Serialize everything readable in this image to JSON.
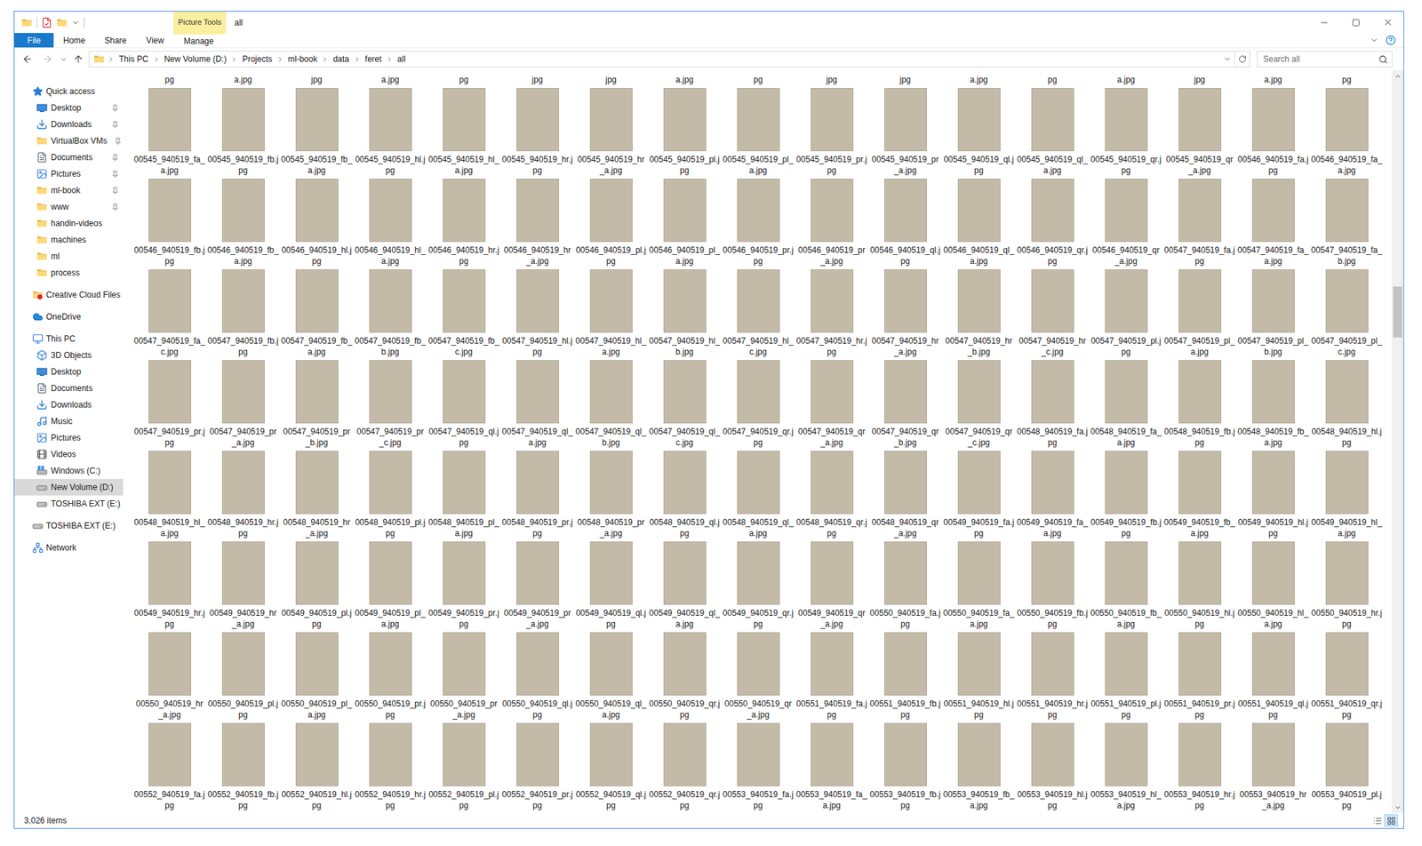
{
  "window": {
    "title": "all",
    "context_label": "Picture Tools"
  },
  "ribbon_tabs": [
    {
      "label": "File",
      "kind": "file",
      "selected": false
    },
    {
      "label": "Home",
      "kind": "tab",
      "selected": false
    },
    {
      "label": "Share",
      "kind": "tab",
      "selected": false
    },
    {
      "label": "View",
      "kind": "tab",
      "selected": false
    },
    {
      "label": "Manage",
      "kind": "contextual",
      "selected": false
    }
  ],
  "nav": {
    "back_disabled": false,
    "forward_disabled": true,
    "up_disabled": false
  },
  "breadcrumb": [
    "This PC",
    "New Volume (D:)",
    "Projects",
    "ml-book",
    "data",
    "feret",
    "all"
  ],
  "search": {
    "placeholder": "Search all"
  },
  "sidebar": {
    "groups": [
      {
        "label": "Quick access",
        "selected": false,
        "children": [
          {
            "label": "Desktop",
            "pinned": true,
            "selected": false
          },
          {
            "label": "Downloads",
            "pinned": true,
            "selected": false
          },
          {
            "label": "VirtualBox VMs",
            "pinned": true,
            "selected": false
          },
          {
            "label": "Documents",
            "pinned": true,
            "selected": false
          },
          {
            "label": "Pictures",
            "pinned": true,
            "selected": false
          },
          {
            "label": "ml-book",
            "pinned": true,
            "selected": false
          },
          {
            "label": "www",
            "pinned": true,
            "selected": false
          },
          {
            "label": "handin-videos",
            "pinned": false,
            "selected": false
          },
          {
            "label": "machines",
            "pinned": false,
            "selected": false
          },
          {
            "label": "ml",
            "pinned": false,
            "selected": false
          },
          {
            "label": "process",
            "pinned": false,
            "selected": false
          }
        ]
      },
      {
        "label": "Creative Cloud Files",
        "selected": false,
        "children": []
      },
      {
        "label": "OneDrive",
        "selected": false,
        "children": []
      },
      {
        "label": "This PC",
        "selected": false,
        "children": [
          {
            "label": "3D Objects",
            "pinned": false,
            "selected": false
          },
          {
            "label": "Desktop",
            "pinned": false,
            "selected": false
          },
          {
            "label": "Documents",
            "pinned": false,
            "selected": false
          },
          {
            "label": "Downloads",
            "pinned": false,
            "selected": false
          },
          {
            "label": "Music",
            "pinned": false,
            "selected": false
          },
          {
            "label": "Pictures",
            "pinned": false,
            "selected": false
          },
          {
            "label": "Videos",
            "pinned": false,
            "selected": false
          },
          {
            "label": "Windows (C:)",
            "pinned": false,
            "selected": false
          },
          {
            "label": "New Volume (D:)",
            "pinned": false,
            "selected": true
          },
          {
            "label": "TOSHIBA EXT (E:)",
            "pinned": false,
            "selected": false
          }
        ]
      },
      {
        "label": "TOSHIBA EXT (E:)",
        "selected": false,
        "children": []
      },
      {
        "label": "Network",
        "selected": false,
        "children": []
      }
    ]
  },
  "files": {
    "cut_labels": [
      "pg",
      "a.jpg",
      "jpg",
      "a.jpg",
      "pg",
      "jpg",
      "jpg",
      "a.jpg",
      "pg",
      "jpg",
      "jpg",
      "a.jpg",
      "pg",
      "a.jpg",
      "jpg",
      "a.jpg",
      "pg"
    ],
    "rows": [
      [
        {
          "name": "00545_940519_fa_a.jpg",
          "selected": false
        },
        {
          "name": "00545_940519_fb.jpg",
          "selected": false
        },
        {
          "name": "00545_940519_fb_a.jpg",
          "selected": false
        },
        {
          "name": "00545_940519_hl.jpg",
          "selected": false
        },
        {
          "name": "00545_940519_hl_a.jpg",
          "selected": false
        },
        {
          "name": "00545_940519_hr.jpg",
          "selected": false
        },
        {
          "name": "00545_940519_hr_a.jpg",
          "selected": false
        },
        {
          "name": "00545_940519_pl.jpg",
          "selected": false
        },
        {
          "name": "00545_940519_pl_a.jpg",
          "selected": false
        },
        {
          "name": "00545_940519_pr.jpg",
          "selected": false
        },
        {
          "name": "00545_940519_pr_a.jpg",
          "selected": false
        },
        {
          "name": "00545_940519_ql.jpg",
          "selected": false
        },
        {
          "name": "00545_940519_ql_a.jpg",
          "selected": false
        },
        {
          "name": "00545_940519_qr.jpg",
          "selected": false
        },
        {
          "name": "00545_940519_qr_a.jpg",
          "selected": false
        },
        {
          "name": "00546_940519_fa.jpg",
          "selected": false
        },
        {
          "name": "00546_940519_fa_a.jpg",
          "selected": false
        }
      ],
      [
        {
          "name": "00546_940519_fb.jpg",
          "selected": false
        },
        {
          "name": "00546_940519_fb_a.jpg",
          "selected": false
        },
        {
          "name": "00546_940519_hl.jpg",
          "selected": false
        },
        {
          "name": "00546_940519_hl_a.jpg",
          "selected": false
        },
        {
          "name": "00546_940519_hr.jpg",
          "selected": false
        },
        {
          "name": "00546_940519_hr_a.jpg",
          "selected": false
        },
        {
          "name": "00546_940519_pl.jpg",
          "selected": false
        },
        {
          "name": "00546_940519_pl_a.jpg",
          "selected": false
        },
        {
          "name": "00546_940519_pr.jpg",
          "selected": false
        },
        {
          "name": "00546_940519_pr_a.jpg",
          "selected": false
        },
        {
          "name": "00546_940519_ql.jpg",
          "selected": false
        },
        {
          "name": "00546_940519_ql_a.jpg",
          "selected": false
        },
        {
          "name": "00546_940519_qr.jpg",
          "selected": false
        },
        {
          "name": "00546_940519_qr_a.jpg",
          "selected": false
        },
        {
          "name": "00547_940519_fa.jpg",
          "selected": false
        },
        {
          "name": "00547_940519_fa_a.jpg",
          "selected": false
        },
        {
          "name": "00547_940519_fa_b.jpg",
          "selected": false
        }
      ],
      [
        {
          "name": "00547_940519_fa_c.jpg",
          "selected": false
        },
        {
          "name": "00547_940519_fb.jpg",
          "selected": false
        },
        {
          "name": "00547_940519_fb_a.jpg",
          "selected": false
        },
        {
          "name": "00547_940519_fb_b.jpg",
          "selected": false
        },
        {
          "name": "00547_940519_fb_c.jpg",
          "selected": false
        },
        {
          "name": "00547_940519_hl.jpg",
          "selected": false
        },
        {
          "name": "00547_940519_hl_a.jpg",
          "selected": false
        },
        {
          "name": "00547_940519_hl_b.jpg",
          "selected": false
        },
        {
          "name": "00547_940519_hl_c.jpg",
          "selected": false
        },
        {
          "name": "00547_940519_hr.jpg",
          "selected": false
        },
        {
          "name": "00547_940519_hr_a.jpg",
          "selected": false
        },
        {
          "name": "00547_940519_hr_b.jpg",
          "selected": false
        },
        {
          "name": "00547_940519_hr_c.jpg",
          "selected": false
        },
        {
          "name": "00547_940519_pl.jpg",
          "selected": false
        },
        {
          "name": "00547_940519_pl_a.jpg",
          "selected": false
        },
        {
          "name": "00547_940519_pl_b.jpg",
          "selected": false
        },
        {
          "name": "00547_940519_pl_c.jpg",
          "selected": false
        }
      ],
      [
        {
          "name": "00547_940519_pr.jpg",
          "selected": false
        },
        {
          "name": "00547_940519_pr_a.jpg",
          "selected": false
        },
        {
          "name": "00547_940519_pr_b.jpg",
          "selected": false
        },
        {
          "name": "00547_940519_pr_c.jpg",
          "selected": false
        },
        {
          "name": "00547_940519_ql.jpg",
          "selected": false
        },
        {
          "name": "00547_940519_ql_a.jpg",
          "selected": false
        },
        {
          "name": "00547_940519_ql_b.jpg",
          "selected": false
        },
        {
          "name": "00547_940519_ql_c.jpg",
          "selected": false
        },
        {
          "name": "00547_940519_qr.jpg",
          "selected": false
        },
        {
          "name": "00547_940519_qr_a.jpg",
          "selected": false
        },
        {
          "name": "00547_940519_qr_b.jpg",
          "selected": false
        },
        {
          "name": "00547_940519_qr_c.jpg",
          "selected": false
        },
        {
          "name": "00548_940519_fa.jpg",
          "selected": false
        },
        {
          "name": "00548_940519_fa_a.jpg",
          "selected": false
        },
        {
          "name": "00548_940519_fb.jpg",
          "selected": false
        },
        {
          "name": "00548_940519_fb_a.jpg",
          "selected": false
        },
        {
          "name": "00548_940519_hl.jpg",
          "selected": false
        }
      ],
      [
        {
          "name": "00548_940519_hl_a.jpg",
          "selected": false
        },
        {
          "name": "00548_940519_hr.jpg",
          "selected": false
        },
        {
          "name": "00548_940519_hr_a.jpg",
          "selected": false
        },
        {
          "name": "00548_940519_pl.jpg",
          "selected": false
        },
        {
          "name": "00548_940519_pl_a.jpg",
          "selected": false
        },
        {
          "name": "00548_940519_pr.jpg",
          "selected": false
        },
        {
          "name": "00548_940519_pr_a.jpg",
          "selected": false
        },
        {
          "name": "00548_940519_ql.jpg",
          "selected": false
        },
        {
          "name": "00548_940519_ql_a.jpg",
          "selected": false
        },
        {
          "name": "00548_940519_qr.jpg",
          "selected": false
        },
        {
          "name": "00548_940519_qr_a.jpg",
          "selected": false
        },
        {
          "name": "00549_940519_fa.jpg",
          "selected": false
        },
        {
          "name": "00549_940519_fa_a.jpg",
          "selected": false
        },
        {
          "name": "00549_940519_fb.jpg",
          "selected": false
        },
        {
          "name": "00549_940519_fb_a.jpg",
          "selected": false
        },
        {
          "name": "00549_940519_hl.jpg",
          "selected": false
        },
        {
          "name": "00549_940519_hl_a.jpg",
          "selected": false
        }
      ],
      [
        {
          "name": "00549_940519_hr.jpg",
          "selected": false
        },
        {
          "name": "00549_940519_hr_a.jpg",
          "selected": false
        },
        {
          "name": "00549_940519_pl.jpg",
          "selected": false
        },
        {
          "name": "00549_940519_pl_a.jpg",
          "selected": false
        },
        {
          "name": "00549_940519_pr.jpg",
          "selected": false
        },
        {
          "name": "00549_940519_pr_a.jpg",
          "selected": false
        },
        {
          "name": "00549_940519_ql.jpg",
          "selected": false
        },
        {
          "name": "00549_940519_ql_a.jpg",
          "selected": false
        },
        {
          "name": "00549_940519_qr.jpg",
          "selected": false
        },
        {
          "name": "00549_940519_qr_a.jpg",
          "selected": false
        },
        {
          "name": "00550_940519_fa.jpg",
          "selected": false
        },
        {
          "name": "00550_940519_fa_a.jpg",
          "selected": false
        },
        {
          "name": "00550_940519_fb.jpg",
          "selected": false
        },
        {
          "name": "00550_940519_fb_a.jpg",
          "selected": false
        },
        {
          "name": "00550_940519_hl.jpg",
          "selected": false
        },
        {
          "name": "00550_940519_hl_a.jpg",
          "selected": false
        },
        {
          "name": "00550_940519_hr.jpg",
          "selected": false
        }
      ],
      [
        {
          "name": "00550_940519_hr_a.jpg",
          "selected": false
        },
        {
          "name": "00550_940519_pl.jpg",
          "selected": false
        },
        {
          "name": "00550_940519_pl_a.jpg",
          "selected": false
        },
        {
          "name": "00550_940519_pr.jpg",
          "selected": false
        },
        {
          "name": "00550_940519_pr_a.jpg",
          "selected": false
        },
        {
          "name": "00550_940519_ql.jpg",
          "selected": false
        },
        {
          "name": "00550_940519_ql_a.jpg",
          "selected": false
        },
        {
          "name": "00550_940519_qr.jpg",
          "selected": false
        },
        {
          "name": "00550_940519_qr_a.jpg",
          "selected": false
        },
        {
          "name": "00551_940519_fa.jpg",
          "selected": false
        },
        {
          "name": "00551_940519_fb.jpg",
          "selected": false
        },
        {
          "name": "00551_940519_hl.jpg",
          "selected": false
        },
        {
          "name": "00551_940519_hr.jpg",
          "selected": false
        },
        {
          "name": "00551_940519_pl.jpg",
          "selected": false
        },
        {
          "name": "00551_940519_pr.jpg",
          "selected": false
        },
        {
          "name": "00551_940519_ql.jpg",
          "selected": false
        },
        {
          "name": "00551_940519_qr.jpg",
          "selected": false
        }
      ],
      [
        {
          "name": "00552_940519_fa.jpg",
          "selected": false
        },
        {
          "name": "00552_940519_fb.jpg",
          "selected": false
        },
        {
          "name": "00552_940519_hl.jpg",
          "selected": false
        },
        {
          "name": "00552_940519_hr.jpg",
          "selected": false
        },
        {
          "name": "00552_940519_pl.jpg",
          "selected": false
        },
        {
          "name": "00552_940519_pr.jpg",
          "selected": false
        },
        {
          "name": "00552_940519_ql.jpg",
          "selected": false
        },
        {
          "name": "00552_940519_qr.jpg",
          "selected": false
        },
        {
          "name": "00553_940519_fa.jpg",
          "selected": false
        },
        {
          "name": "00553_940519_fa_a.jpg",
          "selected": false
        },
        {
          "name": "00553_940519_fb.jpg",
          "selected": false
        },
        {
          "name": "00553_940519_fb_a.jpg",
          "selected": false
        },
        {
          "name": "00553_940519_hl.jpg",
          "selected": false
        },
        {
          "name": "00553_940519_hl_a.jpg",
          "selected": false
        },
        {
          "name": "00553_940519_hr.jpg",
          "selected": false
        },
        {
          "name": "00553_940519_hr_a.jpg",
          "selected": false
        },
        {
          "name": "00553_940519_pl.jpg",
          "selected": false
        }
      ]
    ]
  },
  "scrollbar": {
    "position": 0.285,
    "size": 0.07
  },
  "status_bar": {
    "text": "3,026 items",
    "view_buttons": [
      {
        "selected": false
      },
      {
        "selected": true
      }
    ]
  }
}
